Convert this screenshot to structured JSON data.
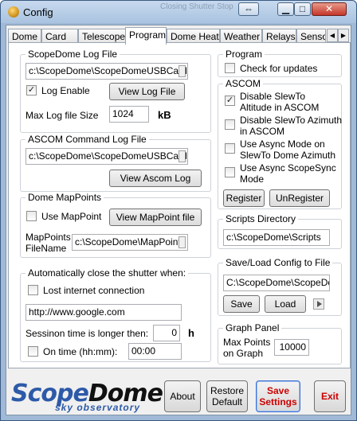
{
  "window": {
    "title": "Config",
    "ghost_text": "Closing Shutter",
    "ghost_text2": "Stop"
  },
  "tabs": [
    "Dome",
    "Card",
    "Telescope",
    "Program",
    "Dome Heat",
    "Weather",
    "Relays",
    "Senso"
  ],
  "scopedome_log": {
    "title": "ScopeDome Log File",
    "path": "c:\\ScopeDome\\ScopeDomeUSBCard_L",
    "enable_label": "Log Enable",
    "enable_checked": true,
    "view_button": "View Log File",
    "max_label": "Max Log file Size",
    "max_value": "1024",
    "unit": "kB"
  },
  "ascom_log": {
    "title": "ASCOM Command Log File",
    "path": "c:\\ScopeDome\\ScopeDomeUSBCard_L",
    "view_button": "View Ascom Log"
  },
  "mappoints": {
    "title": "Dome MapPoints",
    "use_label": "Use MapPoint",
    "use_checked": false,
    "view_button": "View MapPoint file",
    "file_label_1": "MapPoints",
    "file_label_2": "FileName",
    "file_value": "c:\\ScopeDome\\MapPoints"
  },
  "shutter": {
    "title": "Automatically close the shutter when:",
    "lost_label": "Lost internet connection",
    "lost_checked": false,
    "url": "http://www.google.com",
    "session_label": "Sessinon time is longer then:",
    "session_value": "0",
    "session_unit": "h",
    "ontime_label": "On time (hh:mm):",
    "ontime_checked": false,
    "ontime_value": "00:00"
  },
  "program": {
    "title": "Program",
    "check_label": "Check for updates",
    "check_checked": false
  },
  "ascom": {
    "title": "ASCOM",
    "options": [
      {
        "line1": "Disable SlewTo",
        "line2": "Altitude in ASCOM",
        "checked": true
      },
      {
        "line1": "Disable SlewTo Azimuth",
        "line2": "in ASCOM",
        "checked": false
      },
      {
        "line1": "Use Async Mode on",
        "line2": "SlewTo Dome Azimuth",
        "checked": false
      },
      {
        "line1": "Use Async ScopeSync",
        "line2": "Mode",
        "checked": false
      }
    ],
    "register_button": "Register",
    "unregister_button": "UnRegister"
  },
  "scripts": {
    "title": "Scripts Directory",
    "path": "c:\\ScopeDome\\Scripts"
  },
  "saveload": {
    "title": "Save/Load Config to File",
    "path": "C:\\ScopeDome\\ScopeDom",
    "save_button": "Save",
    "load_button": "Load"
  },
  "graph": {
    "title": "Graph Panel",
    "label_1": "Max Points",
    "label_2": "on Graph",
    "value": "10000"
  },
  "logo": {
    "text_a": "Scope",
    "text_b": "Dome",
    "tagline": "sky observatory"
  },
  "footer": {
    "about": "About",
    "restore_1": "Restore",
    "restore_2": "Default",
    "save_1": "Save",
    "save_2": "Settings",
    "exit": "Exit"
  },
  "colors": {
    "accent_red": "#cc0000",
    "title_bar": "#b8cde6",
    "logo_blue": "#2d5aa8"
  }
}
